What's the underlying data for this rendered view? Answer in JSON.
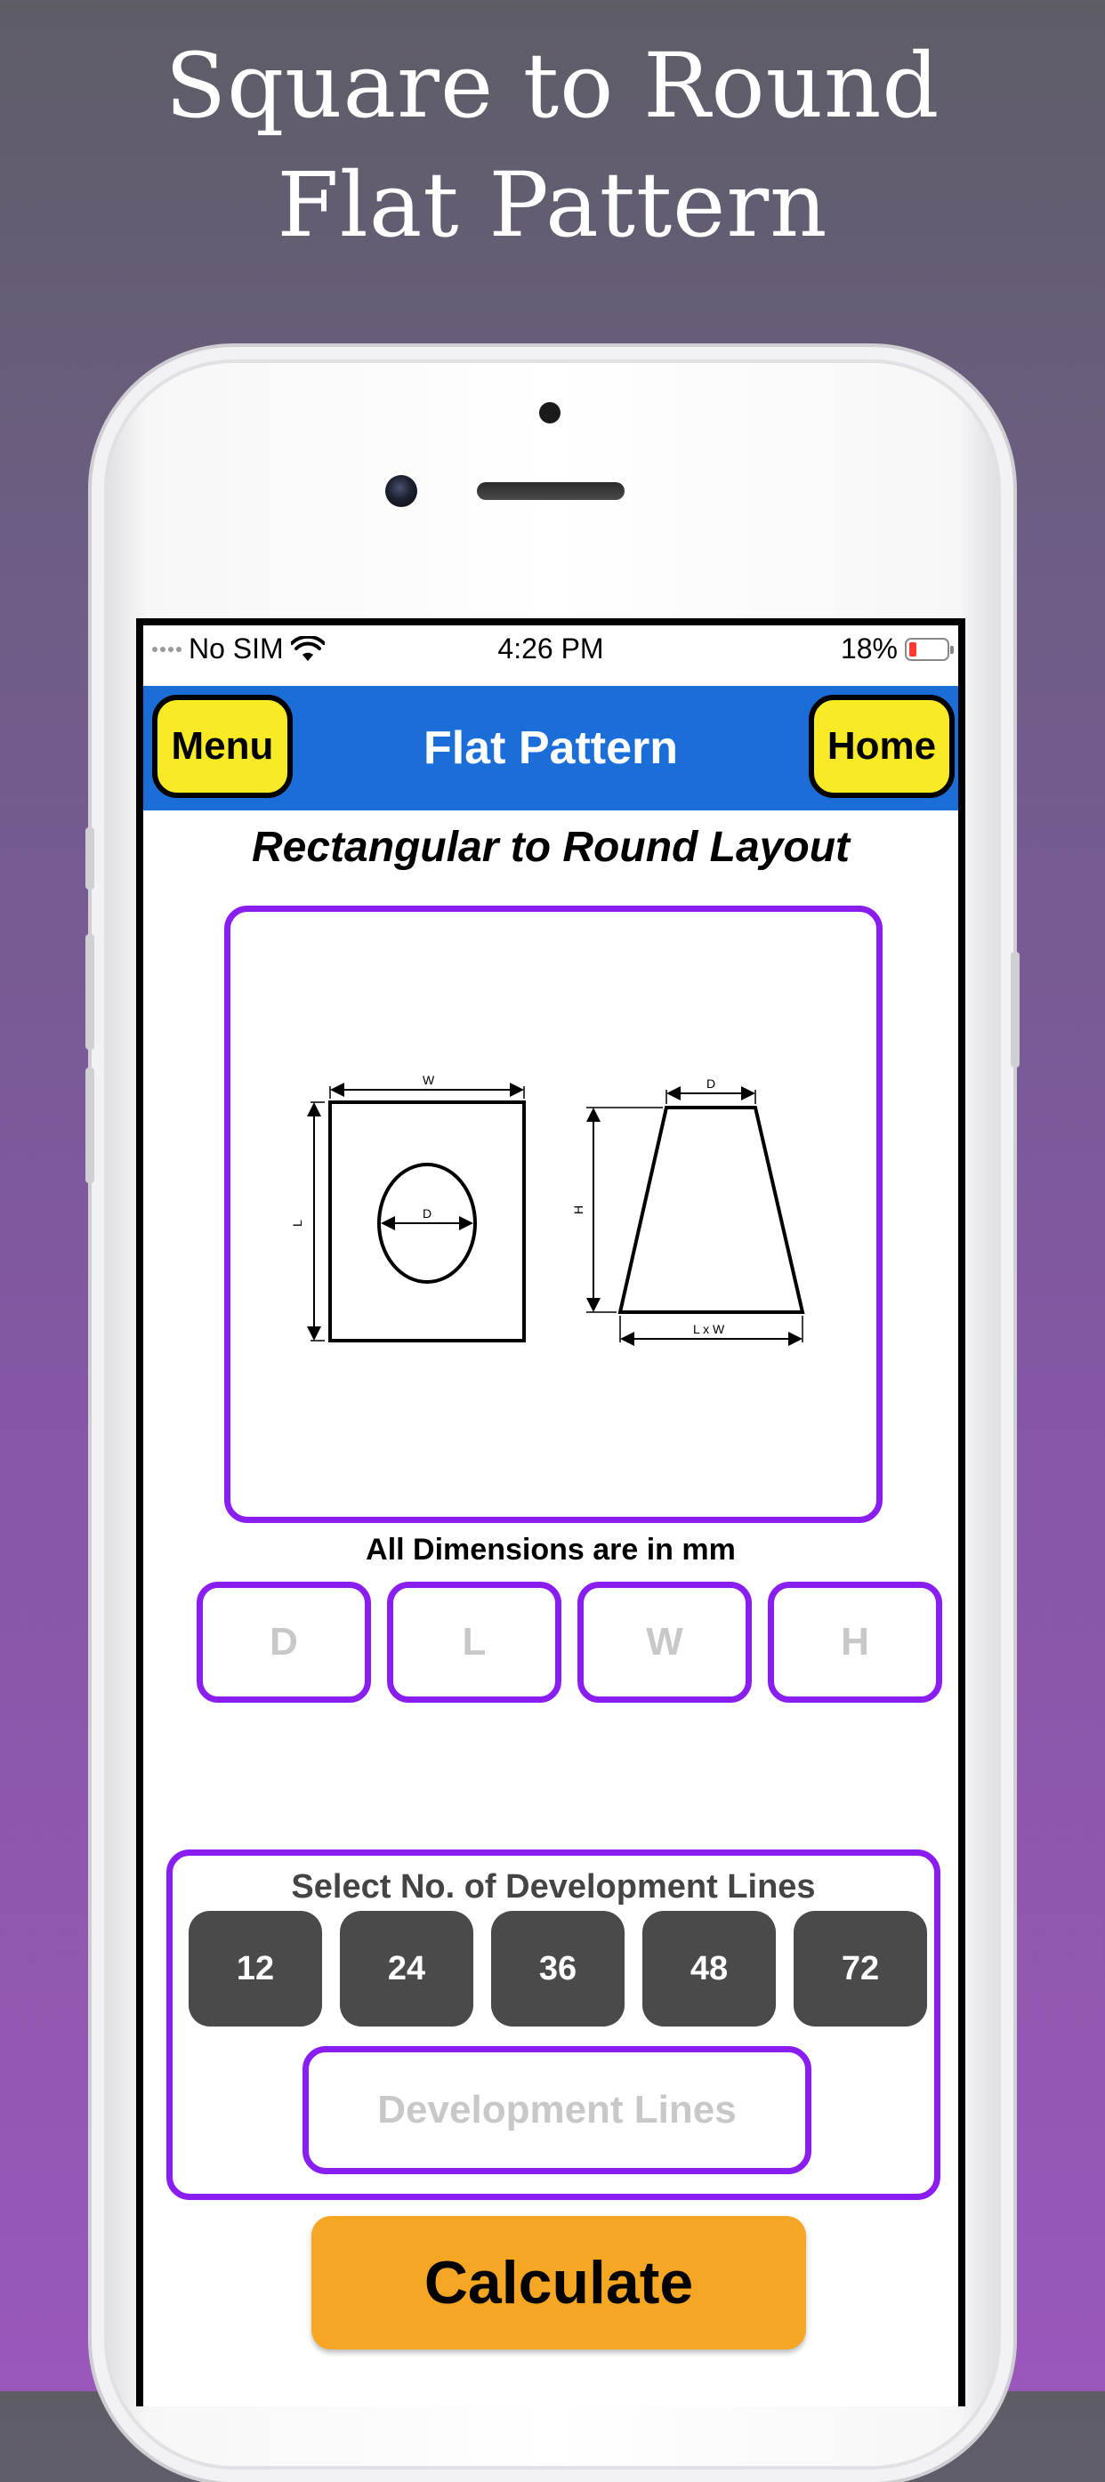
{
  "promo": {
    "line1": "Square to Round",
    "line2": "Flat Pattern"
  },
  "status_bar": {
    "carrier": "No SIM",
    "time": "4:26 PM",
    "battery": "18%"
  },
  "nav": {
    "menu_label": "Menu",
    "title": "Flat Pattern",
    "home_label": "Home"
  },
  "page": {
    "heading": "Rectangular to Round Layout",
    "dimensions_note": "All Dimensions are in mm"
  },
  "diagram": {
    "labels": {
      "w": "W",
      "l": "L",
      "d_circle": "D",
      "d_top": "D",
      "h": "H",
      "lxw": "L x W"
    }
  },
  "inputs": [
    {
      "placeholder": "D"
    },
    {
      "placeholder": "L"
    },
    {
      "placeholder": "W"
    },
    {
      "placeholder": "H"
    }
  ],
  "development": {
    "title": "Select No. of Development Lines",
    "options": [
      "12",
      "24",
      "36",
      "48",
      "72"
    ],
    "input_placeholder": "Development Lines"
  },
  "calculate_label": "Calculate",
  "colors": {
    "accent_purple": "#8a1ef0",
    "nav_blue": "#1b6ed8",
    "button_yellow": "#f8ea25",
    "calc_orange": "#f5a623",
    "option_gray": "#4a4a4a"
  }
}
